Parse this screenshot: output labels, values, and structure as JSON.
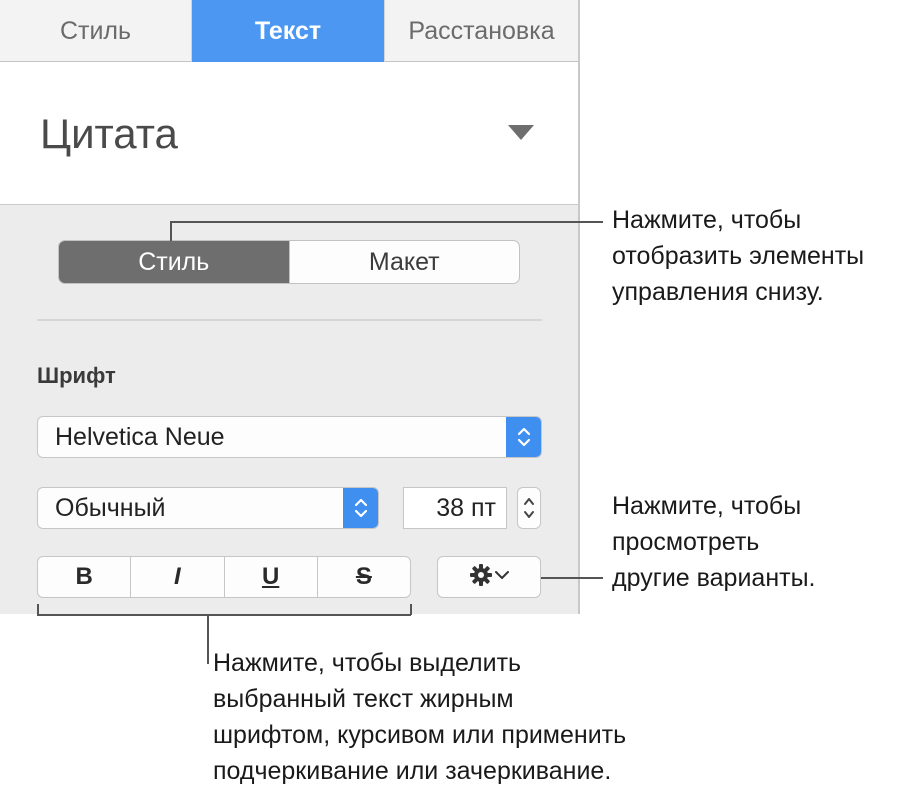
{
  "tabs": {
    "style": "Стиль",
    "text": "Текст",
    "arrange": "Расстановка"
  },
  "paragraph_style": {
    "value": "Цитата"
  },
  "segmented": {
    "style": "Стиль",
    "layout": "Макет"
  },
  "font": {
    "section_label": "Шрифт",
    "family": "Helvetica Neue",
    "typeface": "Обычный",
    "size": "38 пт"
  },
  "format": {
    "bold": "B",
    "italic": "I",
    "underline": "U",
    "strikethrough": "S"
  },
  "callouts": {
    "segment": [
      "Нажмите, чтобы",
      "отобразить элементы",
      "управления снизу."
    ],
    "more": [
      "Нажмите, чтобы",
      "просмотреть",
      "другие варианты."
    ],
    "format": [
      "Нажмите, чтобы выделить",
      "выбранный текст жирным",
      "шрифтом, курсивом или применить",
      "подчеркивание или зачеркивание."
    ]
  },
  "colors": {
    "accent": "#4b97f1",
    "selected_segment": "#6e6e6e",
    "panel_bg": "#ececec"
  },
  "icons": [
    "dropdown-caret-icon",
    "popup-arrows-icon",
    "stepper-icon",
    "gear-icon",
    "chevron-down-icon"
  ]
}
